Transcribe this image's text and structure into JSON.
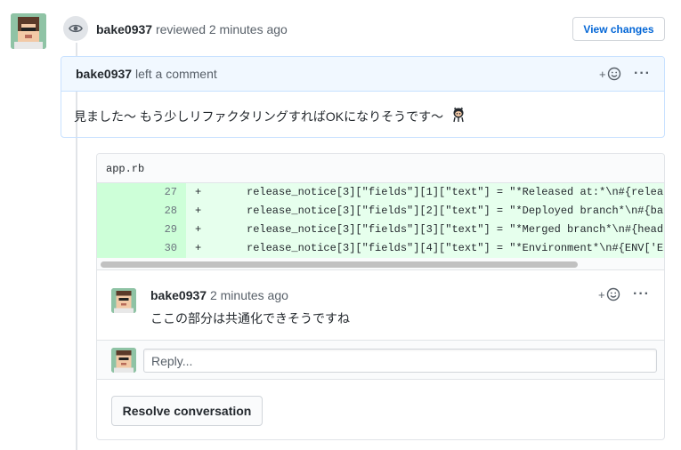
{
  "review": {
    "author": "bake0937",
    "action": "reviewed",
    "time": "2 minutes ago",
    "view_changes_label": "View changes"
  },
  "comment": {
    "author": "bake0937",
    "action": "left a comment",
    "body": "見ました〜 もう少しリファクタリングすればOKになりそうです〜"
  },
  "file": {
    "name": "app.rb"
  },
  "diff": {
    "lines": [
      {
        "num": "27",
        "sign": "+",
        "code": "release_notice[3][\"fields\"][1][\"text\"] = \"*Released at:*\\n#{relea"
      },
      {
        "num": "28",
        "sign": "+",
        "code": "release_notice[3][\"fields\"][2][\"text\"] = \"*Deployed branch*\\n#{ba"
      },
      {
        "num": "29",
        "sign": "+",
        "code": "release_notice[3][\"fields\"][3][\"text\"] = \"*Merged branch*\\n#{head"
      },
      {
        "num": "30",
        "sign": "+",
        "code": "release_notice[3][\"fields\"][4][\"text\"] = \"*Environment*\\n#{ENV['E"
      }
    ]
  },
  "review_comment": {
    "author": "bake0937",
    "time": "2 minutes ago",
    "body": "ここの部分は共通化できそうですね"
  },
  "reply": {
    "placeholder": "Reply..."
  },
  "resolve_label": "Resolve conversation",
  "colors": {
    "accent": "#0366d6",
    "added_line_bg": "#e6ffed",
    "added_num_bg": "#cdffd8",
    "comment_header_bg": "#f1f8ff"
  },
  "icons": [
    "avatar",
    "eye-icon",
    "add-reaction-icon",
    "kebab-menu-icon",
    "octocat-emoji"
  ]
}
